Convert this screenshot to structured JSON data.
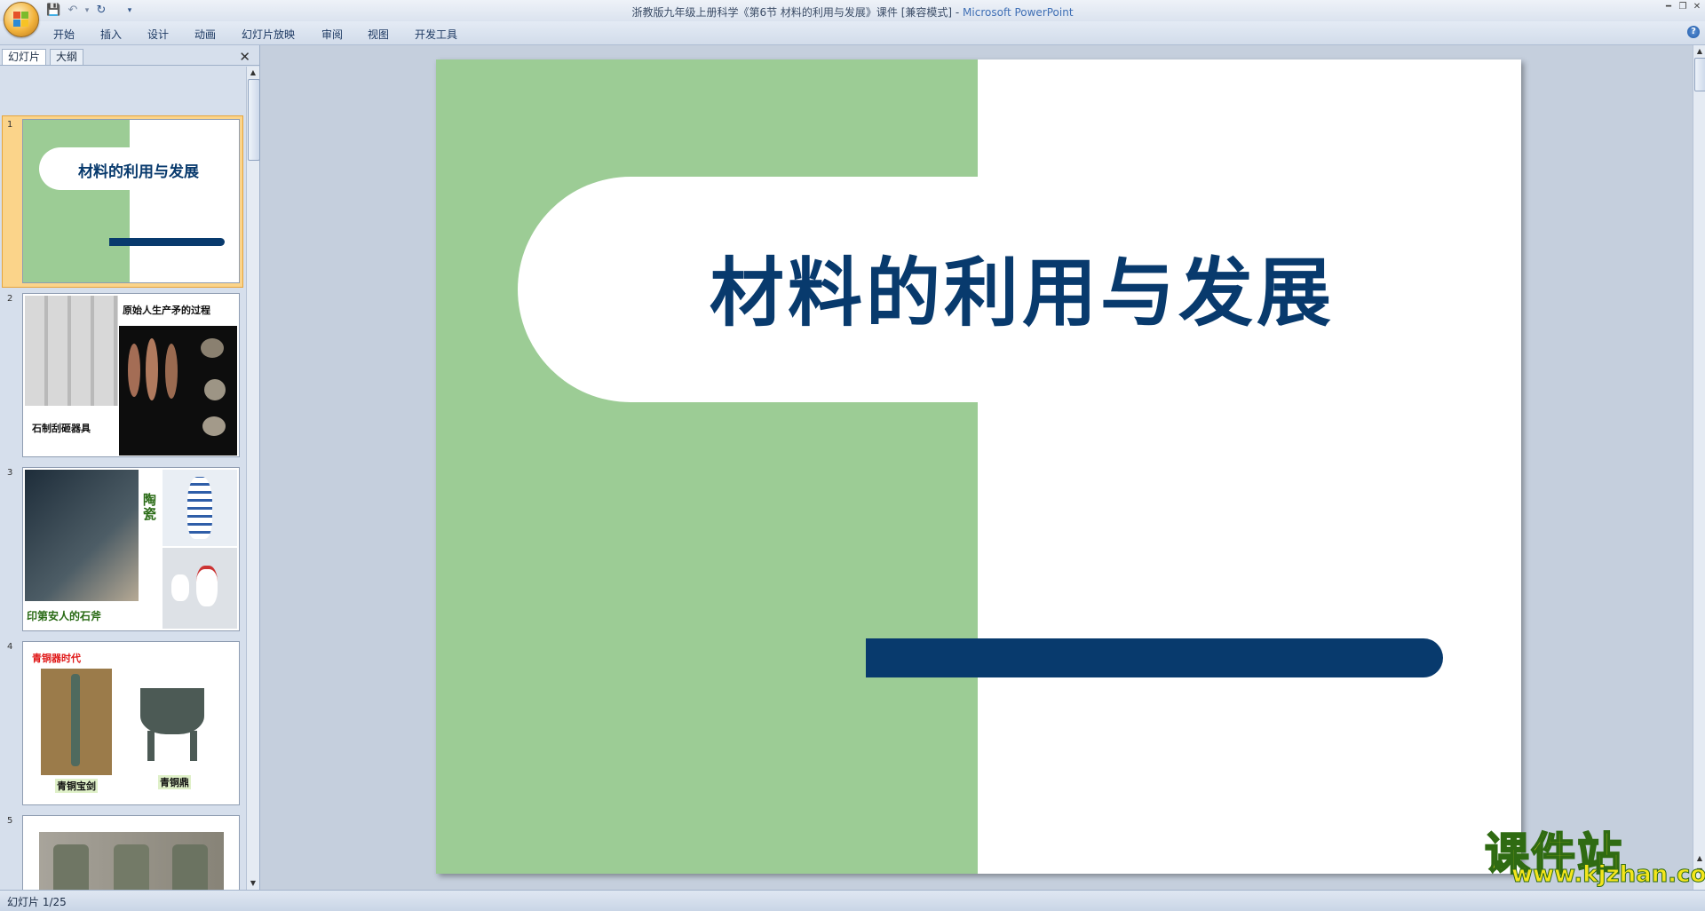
{
  "window": {
    "title_doc": "浙教版九年级上册科学《第6节 材料的利用与发展》课件 [兼容模式] - ",
    "title_app": "Microsoft PowerPoint"
  },
  "ribbon": {
    "tabs": [
      "开始",
      "插入",
      "设计",
      "动画",
      "幻灯片放映",
      "审阅",
      "视图",
      "开发工具"
    ]
  },
  "left_pane": {
    "tabs": [
      "幻灯片",
      "大纲"
    ],
    "slides": [
      {
        "num": "1",
        "title": "材料的利用与发展"
      },
      {
        "num": "2",
        "label_a": "原始人生产矛的过程",
        "label_b": "石制刮砸器具"
      },
      {
        "num": "3",
        "label_a": "陶瓷",
        "label_b": "印第安人的石斧"
      },
      {
        "num": "4",
        "label_a": "青铜器时代",
        "label_b": "青铜宝剑",
        "label_c": "青铜鼎"
      },
      {
        "num": "5"
      }
    ]
  },
  "slide": {
    "title": "材料的利用与发展"
  },
  "status": {
    "slide_indicator": "幻灯片 1/25"
  },
  "watermark": {
    "cn": "课件站",
    "url": "www.kjzhan.com"
  },
  "colors": {
    "slide_green": "#9ccc95",
    "slide_navy": "#083a6d",
    "selection": "#fbd48a"
  }
}
